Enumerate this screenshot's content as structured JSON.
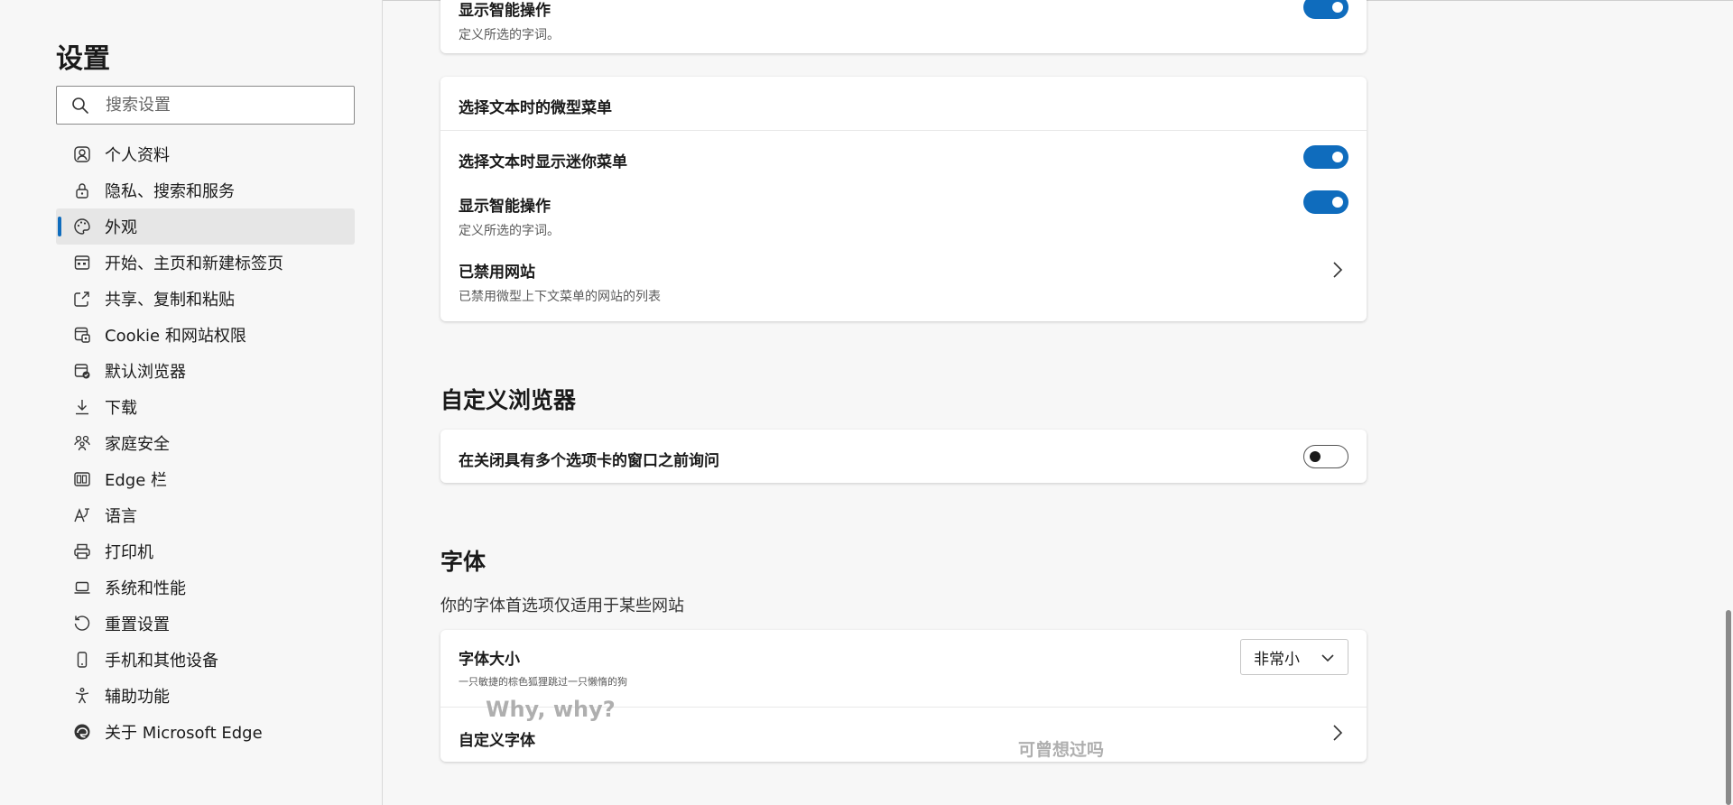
{
  "sidebar": {
    "title": "设置",
    "search_placeholder": "搜索设置",
    "items": [
      {
        "label": "个人资料",
        "icon": "profile-icon"
      },
      {
        "label": "隐私、搜索和服务",
        "icon": "lock-icon"
      },
      {
        "label": "外观",
        "icon": "palette-icon",
        "active": true
      },
      {
        "label": "开始、主页和新建标签页",
        "icon": "start-page-icon"
      },
      {
        "label": "共享、复制和粘贴",
        "icon": "share-icon"
      },
      {
        "label": "Cookie 和网站权限",
        "icon": "site-permissions-icon"
      },
      {
        "label": "默认浏览器",
        "icon": "default-browser-icon"
      },
      {
        "label": "下载",
        "icon": "download-icon"
      },
      {
        "label": "家庭安全",
        "icon": "family-icon"
      },
      {
        "label": "Edge 栏",
        "icon": "edge-bar-icon"
      },
      {
        "label": "语言",
        "icon": "language-icon"
      },
      {
        "label": "打印机",
        "icon": "printer-icon"
      },
      {
        "label": "系统和性能",
        "icon": "laptop-icon"
      },
      {
        "label": "重置设置",
        "icon": "reset-icon"
      },
      {
        "label": "手机和其他设备",
        "icon": "phone-icon"
      },
      {
        "label": "辅助功能",
        "icon": "accessibility-icon"
      },
      {
        "label": "关于 Microsoft Edge",
        "icon": "edge-logo-icon"
      }
    ]
  },
  "top_card": {
    "title": "显示智能操作",
    "desc": "定义所选的字词。",
    "toggle": "on"
  },
  "mini_menu_card": {
    "header": "选择文本时的微型菜单",
    "rows": [
      {
        "title": "选择文本时显示迷你菜单",
        "toggle": "on"
      },
      {
        "title": "显示智能操作",
        "desc": "定义所选的字词。",
        "toggle": "on"
      },
      {
        "title": "已禁用网站",
        "desc": "已禁用微型上下文菜单的网站的列表"
      }
    ]
  },
  "customize_section": {
    "title": "自定义浏览器",
    "row": {
      "title": "在关闭具有多个选项卡的窗口之前询问",
      "toggle": "off"
    }
  },
  "fonts_section": {
    "title": "字体",
    "desc": "你的字体首选项仅适用于某些网站",
    "font_size": {
      "title": "字体大小",
      "desc": "一只敏捷的棕色狐狸跳过一只懒惰的狗",
      "value": "非常小"
    },
    "custom_fonts": {
      "title": "自定义字体"
    }
  },
  "overlays": {
    "text1": "Why, why?",
    "text2": "可曾想过吗"
  },
  "colors": {
    "accent": "#0f6cbd",
    "background": "#f7f7f7",
    "card": "#ffffff"
  }
}
